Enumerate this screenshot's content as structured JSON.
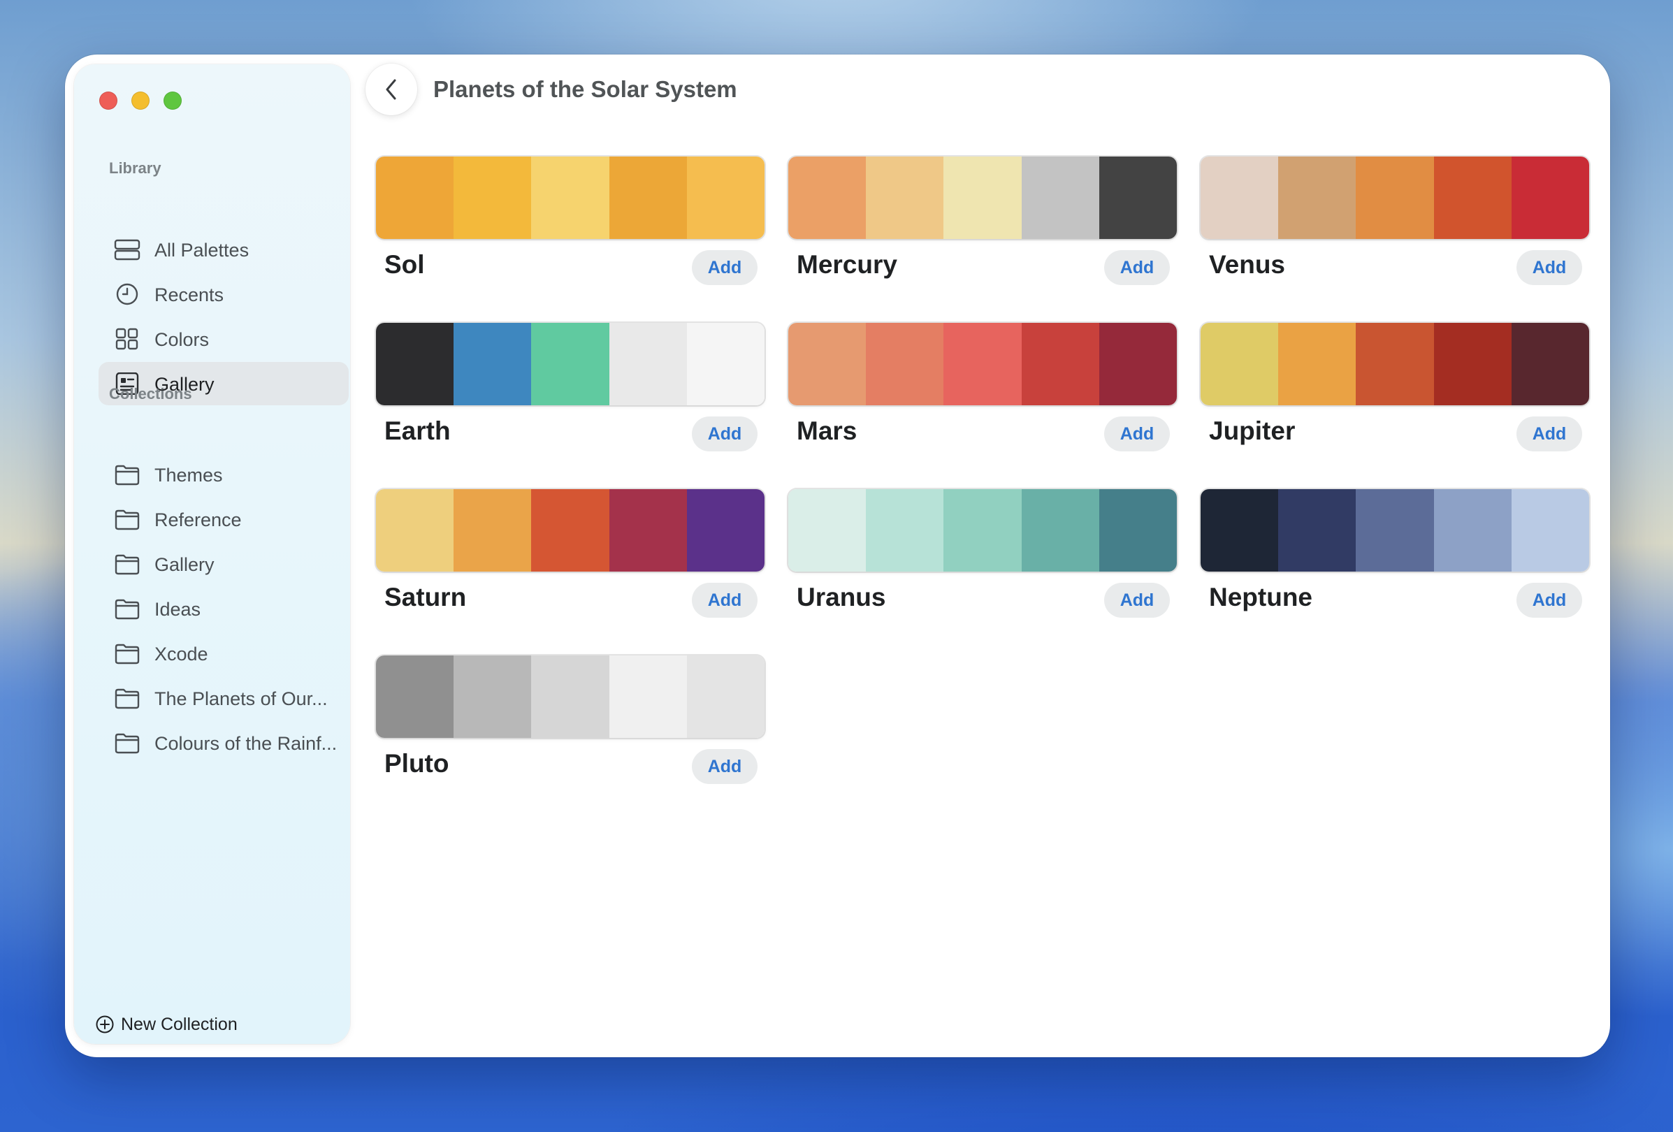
{
  "window": {
    "title": "Planets of the Solar System"
  },
  "sidebar": {
    "library_header": "Library",
    "library": [
      {
        "label": "All Palettes",
        "icon": "all-palettes-icon"
      },
      {
        "label": "Recents",
        "icon": "clock-icon"
      },
      {
        "label": "Colors",
        "icon": "grid-icon"
      },
      {
        "label": "Gallery",
        "icon": "gallery-icon",
        "selected": true
      }
    ],
    "collections_header": "Collections",
    "collections": [
      {
        "label": "Themes",
        "icon": "folder-icon"
      },
      {
        "label": "Reference",
        "icon": "folder-icon"
      },
      {
        "label": "Gallery",
        "icon": "folder-icon"
      },
      {
        "label": "Ideas",
        "icon": "folder-icon"
      },
      {
        "label": "Xcode",
        "icon": "folder-icon"
      },
      {
        "label": "The Planets of Our...",
        "icon": "folder-icon"
      },
      {
        "label": "Colours of the Rainf...",
        "icon": "folder-icon"
      }
    ],
    "new_collection": "New Collection"
  },
  "add_label": "Add",
  "palettes": [
    {
      "name": "Sol",
      "colors": [
        "#eea637",
        "#f3b93b",
        "#f6d36e",
        "#eca737",
        "#f5bd4f"
      ]
    },
    {
      "name": "Mercury",
      "colors": [
        "#eba066",
        "#efc887",
        "#efe5b0",
        "#c3c3c3",
        "#434343"
      ]
    },
    {
      "name": "Venus",
      "colors": [
        "#e3d0c3",
        "#d1a171",
        "#e18d43",
        "#d1542d",
        "#c92c36"
      ]
    },
    {
      "name": "Earth",
      "colors": [
        "#2c2c2e",
        "#3e87bf",
        "#60caa0",
        "#e9e9e9",
        "#f5f5f5"
      ]
    },
    {
      "name": "Mars",
      "colors": [
        "#e69a70",
        "#e47e63",
        "#e7645e",
        "#c8413c",
        "#95293a"
      ]
    },
    {
      "name": "Jupiter",
      "colors": [
        "#dfcb66",
        "#eaa244",
        "#c95531",
        "#a42d22",
        "#58272e"
      ]
    },
    {
      "name": "Saturn",
      "colors": [
        "#eecf7d",
        "#eaa449",
        "#d55633",
        "#a4324b",
        "#5b318a"
      ]
    },
    {
      "name": "Uranus",
      "colors": [
        "#daeee8",
        "#b7e2d7",
        "#91d0c0",
        "#69b0a7",
        "#457f8a"
      ]
    },
    {
      "name": "Neptune",
      "colors": [
        "#1e2636",
        "#313b64",
        "#5c6c98",
        "#8da1c6",
        "#b9cae4"
      ]
    },
    {
      "name": "Pluto",
      "colors": [
        "#909090",
        "#b8b8b8",
        "#d6d6d6",
        "#f0f0f0",
        "#e4e4e4"
      ]
    }
  ]
}
